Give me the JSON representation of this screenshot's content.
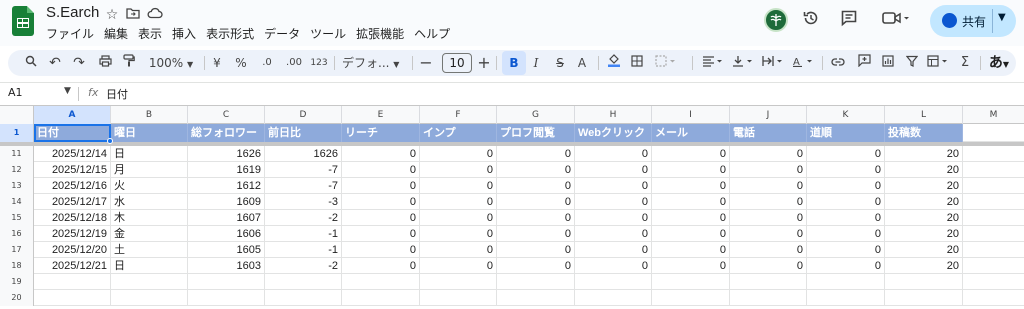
{
  "header": {
    "doc_title": "S.Earch",
    "menu": [
      "ファイル",
      "編集",
      "表示",
      "挿入",
      "表示形式",
      "データ",
      "ツール",
      "拡張機能",
      "ヘルプ"
    ],
    "share_label": "共有",
    "brand_color": "#188038",
    "accent_color": "#c2e7ff"
  },
  "toolbar": {
    "zoom": "100%",
    "currency": "¥",
    "percent": "%",
    "dec_decrease": ".0",
    "dec_increase": ".00",
    "num_format": "123",
    "font_family": "デフォ...",
    "font_size": "10",
    "bold": "B",
    "italic": "I",
    "strike": "S",
    "text_color": "A",
    "input_tool": "あ"
  },
  "formula_bar": {
    "cell_ref": "A1",
    "fx": "fx",
    "value": "日付"
  },
  "sheet": {
    "columns": [
      "A",
      "B",
      "C",
      "D",
      "E",
      "F",
      "G",
      "H",
      "I",
      "J",
      "K",
      "L",
      "M"
    ],
    "header_row_num": "1",
    "headers": [
      "日付",
      "曜日",
      "総フォロワー",
      "前日比",
      "リーチ",
      "インプ",
      "プロフ閲覧",
      "Webクリック",
      "メール",
      "電話",
      "道順",
      "投稿数"
    ],
    "header_color": "#8eaadb",
    "rows": [
      {
        "num": "11",
        "cells": [
          "2025/12/14",
          "日",
          "1626",
          "1626",
          "0",
          "0",
          "0",
          "0",
          "0",
          "0",
          "0",
          "20"
        ]
      },
      {
        "num": "12",
        "cells": [
          "2025/12/15",
          "月",
          "1619",
          "-7",
          "0",
          "0",
          "0",
          "0",
          "0",
          "0",
          "0",
          "20"
        ]
      },
      {
        "num": "13",
        "cells": [
          "2025/12/16",
          "火",
          "1612",
          "-7",
          "0",
          "0",
          "0",
          "0",
          "0",
          "0",
          "0",
          "20"
        ]
      },
      {
        "num": "14",
        "cells": [
          "2025/12/17",
          "水",
          "1609",
          "-3",
          "0",
          "0",
          "0",
          "0",
          "0",
          "0",
          "0",
          "20"
        ]
      },
      {
        "num": "15",
        "cells": [
          "2025/12/18",
          "木",
          "1607",
          "-2",
          "0",
          "0",
          "0",
          "0",
          "0",
          "0",
          "0",
          "20"
        ]
      },
      {
        "num": "16",
        "cells": [
          "2025/12/19",
          "金",
          "1606",
          "-1",
          "0",
          "0",
          "0",
          "0",
          "0",
          "0",
          "0",
          "20"
        ]
      },
      {
        "num": "17",
        "cells": [
          "2025/12/20",
          "土",
          "1605",
          "-1",
          "0",
          "0",
          "0",
          "0",
          "0",
          "0",
          "0",
          "20"
        ]
      },
      {
        "num": "18",
        "cells": [
          "2025/12/21",
          "日",
          "1603",
          "-2",
          "0",
          "0",
          "0",
          "0",
          "0",
          "0",
          "0",
          "20"
        ]
      },
      {
        "num": "19",
        "cells": [
          "",
          "",
          "",
          "",
          "",
          "",
          "",
          "",
          "",
          "",
          "",
          ""
        ]
      },
      {
        "num": "20",
        "cells": [
          "",
          "",
          "",
          "",
          "",
          "",
          "",
          "",
          "",
          "",
          "",
          ""
        ]
      }
    ]
  }
}
